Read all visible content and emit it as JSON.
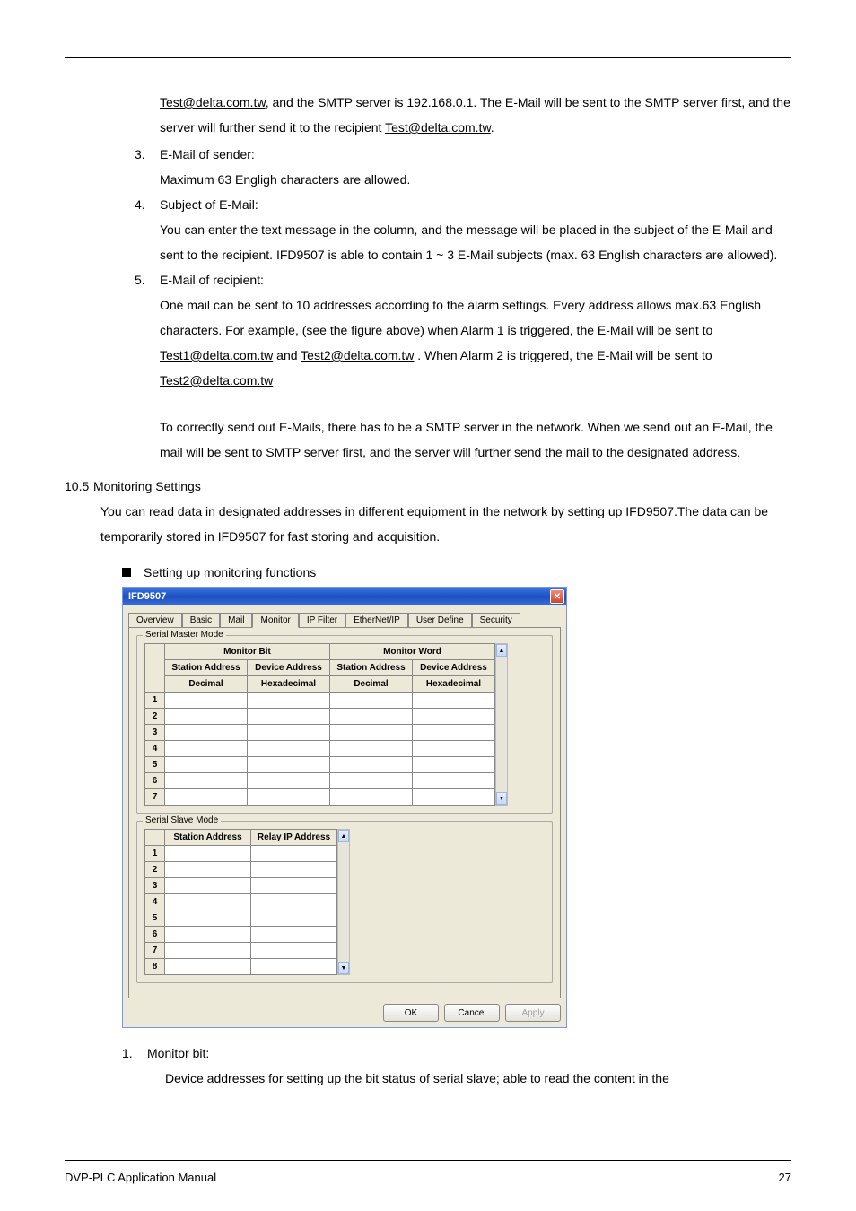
{
  "body": {
    "p1_a": "Test@delta.com.tw",
    "p1_b": ", and the SMTP server is 192.168.0.1. The E-Mail will be sent to the SMTP server first, and the server will further send it to the recipient ",
    "p1_c": "Test@delta.com.tw",
    "p1_d": ".",
    "item3_num": "3.",
    "item3_title": "E-Mail of sender:",
    "item3_body": "Maximum 63 Engligh characters are allowed.",
    "item4_num": "4.",
    "item4_title": "Subject of E-Mail:",
    "item4_body": "You can enter the text message in the column, and the message will be placed in the subject of the E-Mail and sent to the recipient. IFD9507 is able to contain 1 ~ 3 E-Mail subjects (max. 63 English characters are allowed).",
    "item5_num": "5.",
    "item5_title": "E-Mail of recipient:",
    "item5_body_a": "One mail can be sent to 10 addresses according to the alarm settings. Every address allows max.63 English characters. For example, (see the figure above) when Alarm 1 is triggered, the E-Mail will be sent to ",
    "link_t1": "Test1@delta.com.tw",
    "item5_body_b": " and ",
    "link_t2": "Test2@delta.com.tw",
    "item5_body_c": " . When Alarm 2 is triggered, the E-Mail will be sent to ",
    "link_t2b": "Test2@delta.com.tw",
    "item5_body_d": "To correctly send out E-Mails, there has to be a SMTP server in the network. When we send out an E-Mail, the mail will be sent to SMTP server first, and the server will further send the mail to the designated address.",
    "sec_num": "10.5",
    "sec_title": "Monitoring Settings",
    "sec_body": "You can read data in designated addresses in different equipment in the network by setting up IFD9507.The data can be temporarily stored in IFD9507 for fast storing and acquisition.",
    "bullet": "Setting up monitoring functions",
    "after_num": "1.",
    "after_title": "Monitor bit:",
    "after_body": "Device addresses for setting up the bit status of serial slave; able to read the content in the"
  },
  "dialog": {
    "title": "IFD9507",
    "tabs": [
      "Overview",
      "Basic",
      "Mail",
      "Monitor",
      "IP Filter",
      "EtherNet/IP",
      "User Define",
      "Security"
    ],
    "group1_title": "Serial Master Mode",
    "g1_top1": "Monitor Bit",
    "g1_top2": "Monitor Word",
    "g1_h1": "Station Address",
    "g1_h2": "Device Address",
    "g1_h3": "Station Address",
    "g1_h4": "Device Address",
    "g1_s1": "Decimal",
    "g1_s2": "Hexadecimal",
    "g1_s3": "Decimal",
    "g1_s4": "Hexadecimal",
    "g1_rows": [
      "1",
      "2",
      "3",
      "4",
      "5",
      "6",
      "7"
    ],
    "group2_title": "Serial Slave Mode",
    "g2_h1": "Station Address",
    "g2_h2": "Relay IP Address",
    "g2_rows": [
      "1",
      "2",
      "3",
      "4",
      "5",
      "6",
      "7",
      "8"
    ],
    "btn_ok": "OK",
    "btn_cancel": "Cancel",
    "btn_apply": "Apply"
  },
  "footer": {
    "left": "DVP-PLC Application Manual",
    "right": "27"
  }
}
